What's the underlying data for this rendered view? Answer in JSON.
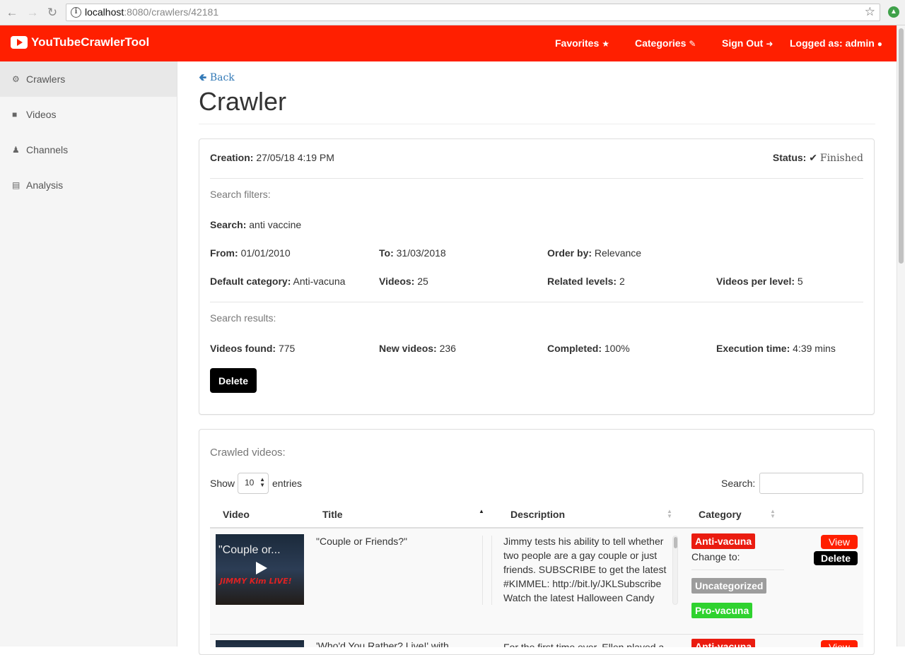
{
  "browser": {
    "url_host": "localhost",
    "url_path": ":8080/crawlers/42181"
  },
  "navbar": {
    "brand": "YouTubeCrawlerTool",
    "favorites": "Favorites",
    "categories": "Categories",
    "sign_out": "Sign Out",
    "logged_as": "Logged as: admin"
  },
  "sidebar": {
    "items": [
      {
        "label": "Crawlers",
        "icon": "gears-icon"
      },
      {
        "label": "Videos",
        "icon": "video-camera-icon"
      },
      {
        "label": "Channels",
        "icon": "users-icon"
      },
      {
        "label": "Analysis",
        "icon": "bar-chart-icon"
      }
    ]
  },
  "page": {
    "back": "Back",
    "title": "Crawler"
  },
  "crawler": {
    "creation_label": "Creation:",
    "creation_value": "27/05/18 4:19 PM",
    "status_label": "Status:",
    "status_value": "Finished",
    "search_filters_heading": "Search filters:",
    "search_label": "Search:",
    "search_value": "anti vaccine",
    "from_label": "From:",
    "from_value": "01/01/2010",
    "to_label": "To:",
    "to_value": "31/03/2018",
    "order_label": "Order by:",
    "order_value": "Relevance",
    "default_category_label": "Default category:",
    "default_category_value": "Anti-vacuna",
    "videos_label": "Videos:",
    "videos_value": "25",
    "related_levels_label": "Related levels:",
    "related_levels_value": "2",
    "videos_per_level_label": "Videos per level:",
    "videos_per_level_value": "5",
    "search_results_heading": "Search results:",
    "videos_found_label": "Videos found:",
    "videos_found_value": "775",
    "new_videos_label": "New videos:",
    "new_videos_value": "236",
    "completed_label": "Completed:",
    "completed_value": "100%",
    "execution_time_label": "Execution time:",
    "execution_time_value": "4:39 mins",
    "delete_button": "Delete"
  },
  "crawled": {
    "heading": "Crawled videos:",
    "show_label": "Show",
    "entries_value": "10",
    "entries_label": "entries",
    "search_label": "Search:",
    "columns": [
      "Video",
      "Title",
      "Description",
      "Category"
    ],
    "rows": [
      {
        "thumb_text": "\"Couple or...",
        "thumb_logo": "JIMMY Kim LIVE!",
        "title": "\"Couple or Friends?\"",
        "description": "Jimmy tests his ability to tell whether two people are a gay couple or just friends. SUBSCRIBE to get the latest #KIMMEL: http://bit.ly/JKLSubscribe Watch the latest Halloween Candy",
        "category": "Anti-vacuna",
        "change_to": "Change to:",
        "options": [
          "Uncategorized",
          "Pro-vacuna"
        ],
        "view": "View",
        "delete": "Delete"
      },
      {
        "title": "'Who'd You Rather? Live!' with",
        "description": "For the first time ever, Ellen played a",
        "category": "Anti-vacuna",
        "view": "View"
      }
    ]
  },
  "colors": {
    "brand_red": "#ff1f00",
    "label_red": "#ea1c10",
    "label_gray": "#9d9d9d",
    "label_green": "#2fd22f",
    "link_blue": "#337ab7"
  }
}
